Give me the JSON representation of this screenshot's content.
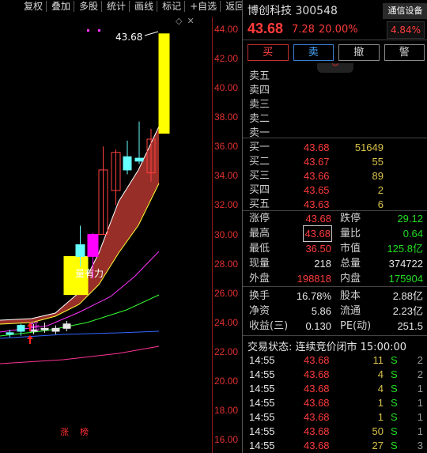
{
  "toolbar": [
    "复权",
    "叠加",
    "多股",
    "统计",
    "画线",
    "标记",
    "+自选",
    "返回"
  ],
  "chart_data": {
    "type": "candlestick",
    "y_ticks": [
      "44.00",
      "42.00",
      "40.00",
      "38.00",
      "36.00",
      "34.00",
      "32.00",
      "30.00",
      "28.00",
      "26.00",
      "24.00",
      "22.00",
      "20.00",
      "18.00",
      "16.00"
    ],
    "ylim": [
      15.1,
      44.8
    ],
    "candles": [
      {
        "o": 23.2,
        "h": 23.5,
        "l": 23.0,
        "c": 23.3,
        "color": "cyan"
      },
      {
        "o": 23.4,
        "h": 23.9,
        "l": 23.1,
        "c": 23.8,
        "color": "cyan"
      },
      {
        "o": 23.5,
        "h": 23.9,
        "l": 23.2,
        "c": 23.4,
        "color": "white"
      },
      {
        "o": 23.5,
        "h": 24.0,
        "l": 23.3,
        "c": 23.6,
        "color": "white"
      },
      {
        "o": 23.4,
        "h": 23.8,
        "l": 23.2,
        "c": 23.6,
        "color": "white"
      },
      {
        "o": 23.6,
        "h": 24.1,
        "l": 23.4,
        "c": 23.9,
        "color": "white"
      },
      {
        "o": 25.9,
        "h": 28.5,
        "l": 25.9,
        "c": 28.5,
        "color": "yellow"
      },
      {
        "o": 28.5,
        "h": 30.6,
        "l": 27.8,
        "c": 29.3,
        "color": "cyan"
      },
      {
        "o": 28.5,
        "h": 30.1,
        "l": 27.0,
        "c": 30.0,
        "color": "magenta"
      },
      {
        "o": 30.0,
        "h": 36.0,
        "l": 30.0,
        "c": 34.4,
        "color": "red-hollow"
      },
      {
        "o": 33.0,
        "h": 35.8,
        "l": 32.0,
        "c": 35.6,
        "color": "red-hollow"
      },
      {
        "o": 35.3,
        "h": 36.4,
        "l": 34.1,
        "c": 34.4,
        "color": "cyan"
      },
      {
        "o": 35.2,
        "h": 37.7,
        "l": 34.8,
        "c": 35.0,
        "color": "cyan"
      },
      {
        "o": 34.2,
        "h": 37.2,
        "l": 33.6,
        "c": 36.5,
        "color": "red-hollow"
      },
      {
        "o": 36.9,
        "h": 43.68,
        "l": 36.9,
        "c": 43.68,
        "color": "yellow"
      }
    ],
    "annotations": {
      "peak": "43.68",
      "text": "量有力",
      "marker": "托"
    },
    "badges": [
      "涨",
      "榜"
    ]
  },
  "panel": {
    "name_code": "博创科技 300548",
    "device_label": "通信设备",
    "price": "43.68",
    "change": "7.28",
    "change_pct": "20.00%",
    "sector_pct": "4.84%",
    "actions": {
      "buy": "买",
      "sell": "卖",
      "cancel": "撤",
      "alert": "警"
    },
    "collapse_icon": "chevron-double-down",
    "asks": [
      {
        "label": "卖五",
        "price": "",
        "vol": ""
      },
      {
        "label": "卖四",
        "price": "",
        "vol": ""
      },
      {
        "label": "卖三",
        "price": "",
        "vol": ""
      },
      {
        "label": "卖二",
        "price": "",
        "vol": ""
      },
      {
        "label": "卖一",
        "price": "",
        "vol": ""
      }
    ],
    "bids": [
      {
        "label": "买一",
        "price": "43.68",
        "vol": "51649"
      },
      {
        "label": "买二",
        "price": "43.67",
        "vol": "55"
      },
      {
        "label": "买三",
        "price": "43.66",
        "vol": "89"
      },
      {
        "label": "买四",
        "price": "43.65",
        "vol": "2"
      },
      {
        "label": "买五",
        "price": "43.63",
        "vol": "6"
      }
    ],
    "stats": [
      {
        "l1": "涨停",
        "v1": "43.68",
        "l2": "跌停",
        "v2": "29.12"
      },
      {
        "l1": "最高",
        "v1": "43.68",
        "l2": "量比",
        "v2": "0.64"
      },
      {
        "l1": "最低",
        "v1": "36.50",
        "l2": "市值",
        "v2": "125.8亿"
      },
      {
        "l1": "现量",
        "v1": "218",
        "l2": "总量",
        "v2": "374722"
      },
      {
        "l1": "外盘",
        "v1": "198818",
        "l2": "内盘",
        "v2": "175904"
      },
      {
        "l1": "换手",
        "v1": "16.78%",
        "l2": "股本",
        "v2": "2.88亿"
      },
      {
        "l1": "净资",
        "v1": "5.86",
        "l2": "流通",
        "v2": "2.23亿"
      },
      {
        "l1": "收益(三)",
        "v1": "0.130",
        "l2": "PE(动)",
        "v2": "251.5"
      }
    ],
    "trade_status": "交易状态: 连续竞价闭市 15:00:00",
    "ticks": [
      {
        "t": "14:55",
        "p": "43.68",
        "v": "11",
        "s": "S",
        "n": "2"
      },
      {
        "t": "14:55",
        "p": "43.68",
        "v": "4",
        "s": "S",
        "n": "2"
      },
      {
        "t": "14:55",
        "p": "43.68",
        "v": "4",
        "s": "S",
        "n": "1"
      },
      {
        "t": "14:55",
        "p": "43.68",
        "v": "1",
        "s": "S",
        "n": "1"
      },
      {
        "t": "14:55",
        "p": "43.68",
        "v": "1",
        "s": "S",
        "n": "1"
      },
      {
        "t": "14:55",
        "p": "43.68",
        "v": "50",
        "s": "S",
        "n": "1"
      },
      {
        "t": "14:55",
        "p": "43.68",
        "v": "27",
        "s": "S",
        "n": "3"
      }
    ]
  }
}
